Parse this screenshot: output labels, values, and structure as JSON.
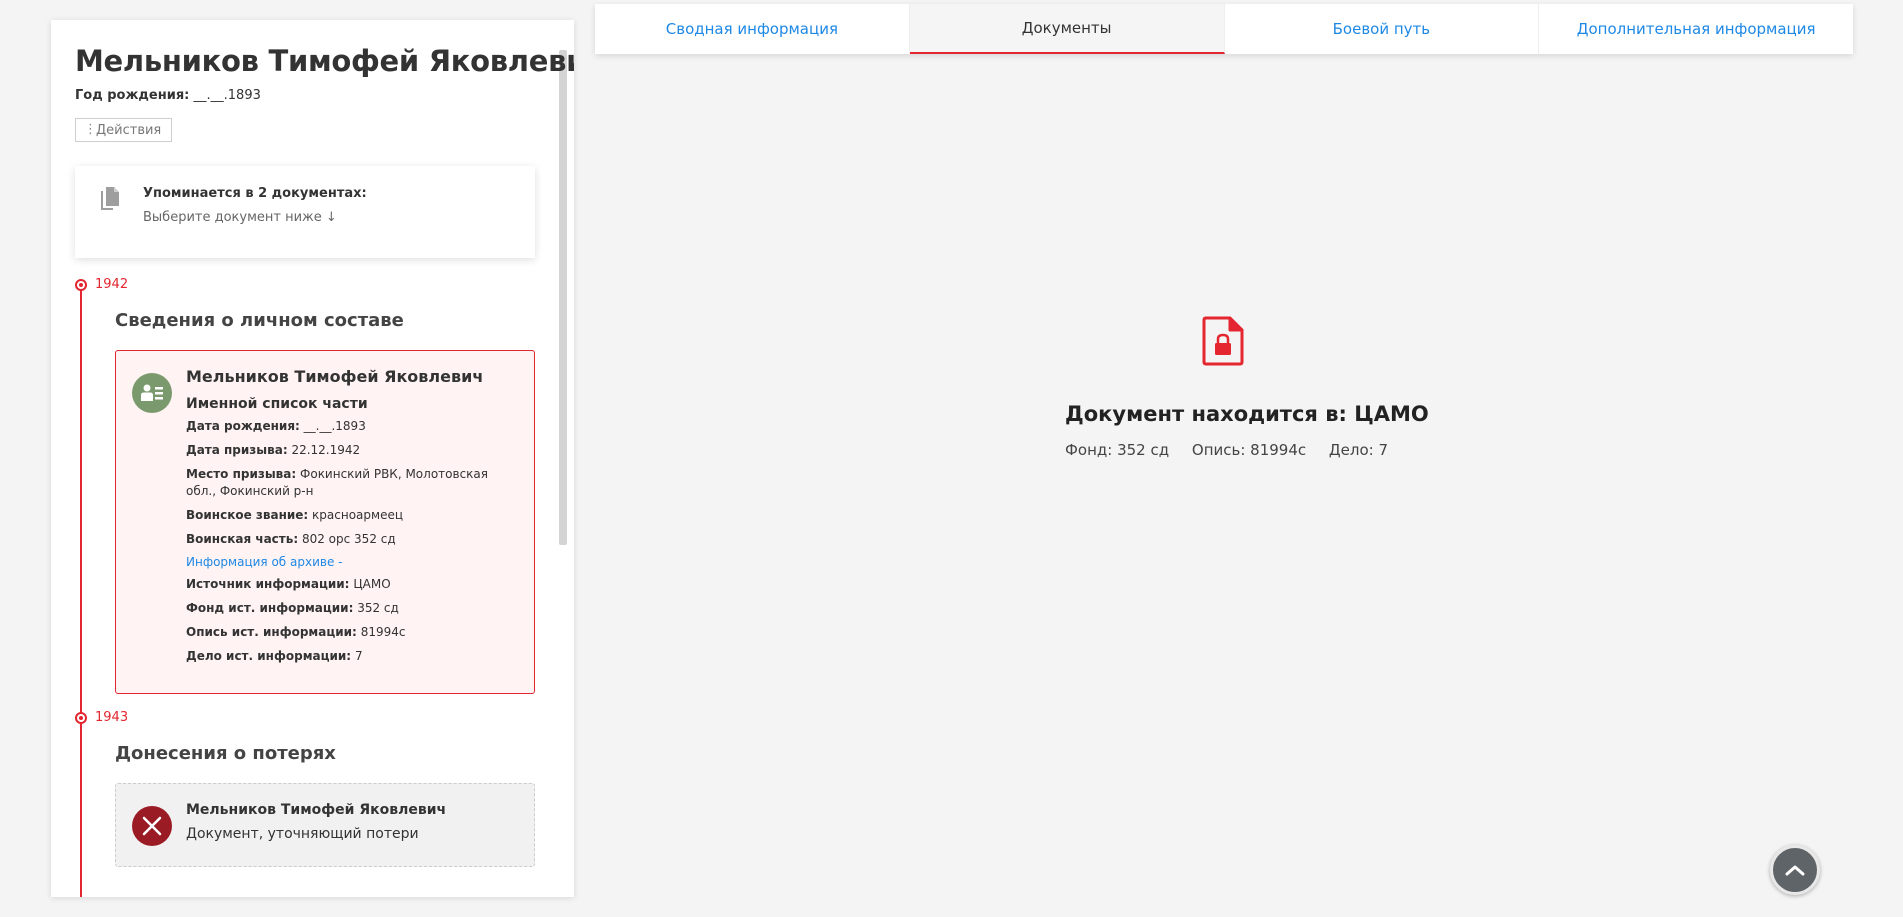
{
  "person": {
    "name": "Мельников Тимофей Яковлевич",
    "birth_label": "Год рождения:",
    "birth_value": "__.__.1893",
    "actions_label": "Действия"
  },
  "mentions": {
    "title": "Упоминается в 2 документах:",
    "subtitle": "Выберите документ ниже ↓"
  },
  "timeline": [
    {
      "year": "1942",
      "section": "Сведения о личном составе",
      "record": {
        "name": "Мельников Тимофей Яковлевич",
        "type": "Именной список части",
        "fields": [
          {
            "label": "Дата рождения:",
            "value": "__.__.1893"
          },
          {
            "label": "Дата призыва:",
            "value": "22.12.1942"
          },
          {
            "label": "Место призыва:",
            "value": "Фокинский РВК, Молотовская обл., Фокинский р-н"
          },
          {
            "label": "Воинское звание:",
            "value": "красноармеец"
          },
          {
            "label": "Воинская часть:",
            "value": "802 орс 352 сд"
          }
        ],
        "archive_link": "Информация об архиве -",
        "archive_fields": [
          {
            "label": "Источник информации:",
            "value": "ЦАМО"
          },
          {
            "label": "Фонд ист. информации:",
            "value": "352 сд"
          },
          {
            "label": "Опись ист. информации:",
            "value": "81994с"
          },
          {
            "label": "Дело ист. информации:",
            "value": "7"
          }
        ]
      }
    },
    {
      "year": "1943",
      "section": "Донесения о потерях",
      "record": {
        "name": "Мельников Тимофей Яковлевич",
        "type": "Документ, уточняющий потери"
      }
    }
  ],
  "tabs": [
    {
      "label": "Сводная информация",
      "active": false
    },
    {
      "label": "Документы",
      "active": true
    },
    {
      "label": "Боевой путь",
      "active": false
    },
    {
      "label": "Дополнительная информация",
      "active": false
    }
  ],
  "document_location": {
    "title": "Документ находится в: ЦАМО",
    "fond": "Фонд: 352 сд",
    "opis": "Опись: 81994с",
    "delo": "Дело: 7"
  },
  "colors": {
    "accent": "#e3262f",
    "link": "#1e88e5",
    "avatar_green": "#7a9a6e",
    "loss_red": "#9b1b25"
  },
  "icons": {
    "mention": "documents-icon",
    "record": "personnel-card-icon",
    "loss": "cross-icon",
    "location": "locked-document-icon",
    "scroll": "chevron-up-icon"
  }
}
